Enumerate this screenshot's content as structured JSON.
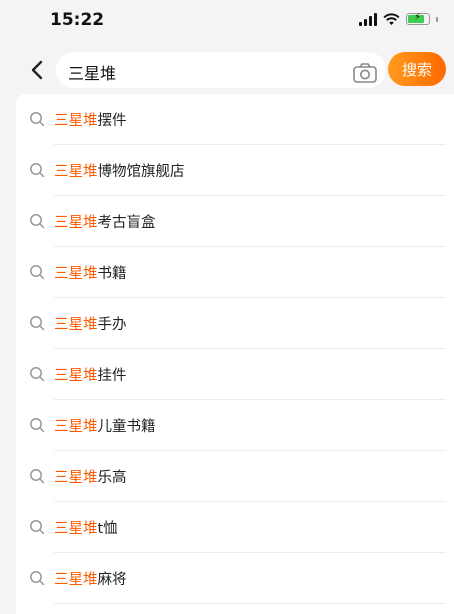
{
  "status": {
    "time": "15:22"
  },
  "search": {
    "query": "三星堆",
    "button_label": "搜索"
  },
  "highlight": "三星堆",
  "suggestions": [
    {
      "prefix": "三星堆",
      "suffix": "摆件"
    },
    {
      "prefix": "三星堆",
      "suffix": "博物馆旗舰店"
    },
    {
      "prefix": "三星堆",
      "suffix": "考古盲盒"
    },
    {
      "prefix": "三星堆",
      "suffix": "书籍"
    },
    {
      "prefix": "三星堆",
      "suffix": "手办"
    },
    {
      "prefix": "三星堆",
      "suffix": "挂件"
    },
    {
      "prefix": "三星堆",
      "suffix": "儿童书籍"
    },
    {
      "prefix": "三星堆",
      "suffix": "乐高"
    },
    {
      "prefix": "三星堆",
      "suffix": "t恤"
    },
    {
      "prefix": "三星堆",
      "suffix": "麻将"
    }
  ],
  "icons": {
    "back": "chevron-left-icon",
    "camera": "camera-icon",
    "suggestion": "search-icon"
  },
  "colors": {
    "accent": "#ff6a00",
    "highlight": "#ff5a00"
  }
}
